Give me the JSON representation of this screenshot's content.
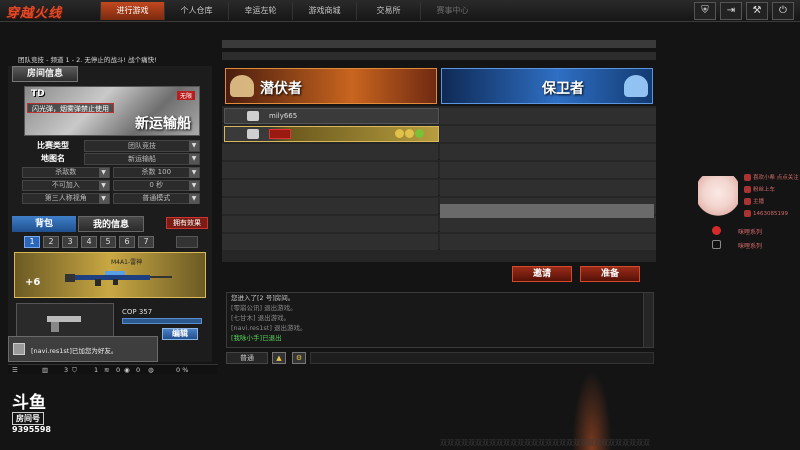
{
  "app": {
    "logo": "穿越火线",
    "nav_tabs": [
      {
        "label": "进行游戏",
        "active": true
      },
      {
        "label": "个人仓库",
        "active": false
      },
      {
        "label": "幸运左轮",
        "active": false
      },
      {
        "label": "游戏商城",
        "active": false
      },
      {
        "label": "交易所",
        "active": false
      },
      {
        "label": "赛事中心",
        "active": false,
        "disabled": true
      }
    ],
    "top_icons": [
      "shield-icon",
      "exit-icon",
      "wrench-icon",
      "power-icon"
    ]
  },
  "notice": "团队竞技 - 频道 1 - 2. 无停止的战斗! 战个痛快!",
  "room_info": {
    "tab_label": "房间信息",
    "mode": "TD",
    "ban_text": "闪光弹，烟雾弹禁止使用",
    "badge": "无限",
    "map_name": "新运输船",
    "rows": [
      {
        "label": "比赛类型",
        "value": "团队竞技"
      },
      {
        "label": "地图名",
        "value": "新运输船"
      }
    ],
    "options": [
      [
        "杀敌数",
        "杀数 100"
      ],
      [
        "不可加入",
        "0 秒"
      ],
      [
        "第三人称视角",
        "普通模式"
      ]
    ]
  },
  "bag": {
    "tab_bag": "背包",
    "tab_info": "我的信息",
    "effect_label": "拥有效果",
    "slots": [
      "1",
      "2",
      "3",
      "4",
      "5",
      "6",
      "7"
    ],
    "active_slot": "1",
    "weapon_plus": "+6",
    "weapon_name": "M4A1-雷神",
    "pistol_name": "COP 357",
    "pistol_btn": "编辑"
  },
  "friend_toast": "[navi.res1st]已加您为好友。",
  "statusbar": {
    "level": "3",
    "count1": "1",
    "count2": "0",
    "count3": "0",
    "pct": "0 %"
  },
  "douyu": {
    "logo": "斗鱼",
    "label": "房间号",
    "room_id": "9395598"
  },
  "teams": {
    "red": "潜伏者",
    "blue": "保卫者"
  },
  "players": [
    {
      "name": "mily665",
      "team": "red"
    },
    {
      "name": "",
      "team": "red",
      "gold": true
    }
  ],
  "buttons": {
    "invite": "邀请",
    "ready": "准备"
  },
  "chat": {
    "lines": [
      {
        "text": "您进入了[2 号]房间。",
        "style": "normal"
      },
      {
        "text": "[零崩公讯] 退出游戏。",
        "style": "dim"
      },
      {
        "text": "[七甘木] 退出游戏。",
        "style": "dim"
      },
      {
        "text": "[navi.res1st] 退出游戏。",
        "style": "dim"
      },
      {
        "text": "[我咏小手]已退出",
        "style": "green"
      }
    ],
    "channel": "普通"
  },
  "overlay": {
    "social": [
      "喜欢小希 点点关注",
      "粉丝上车",
      "主播",
      "1463085199"
    ],
    "weibo": "咪哩系列",
    "tiktok": "咪哩系列"
  },
  "watermark": "双双双双双双双双双双双双双双双双双双双双双双双双双双双双双双"
}
